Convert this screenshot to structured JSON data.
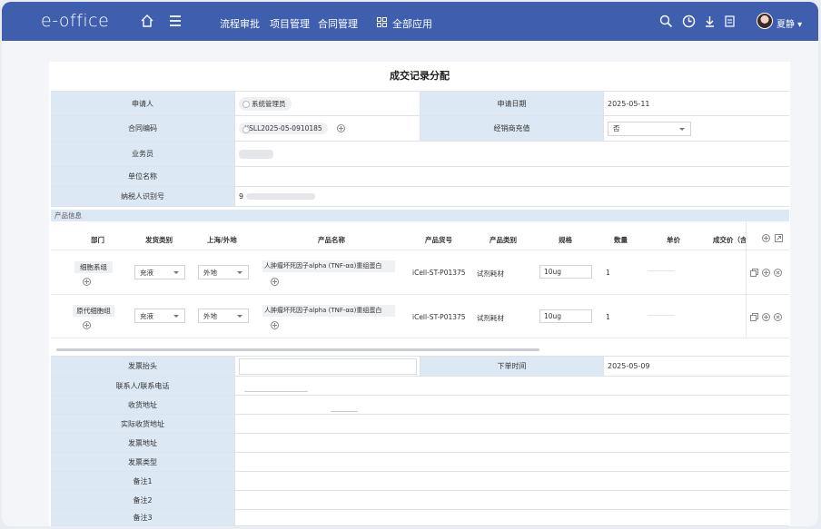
{
  "topbar": {
    "logo": "e-office",
    "nav": [
      "流程审批",
      "项目管理",
      "合同管理"
    ],
    "all_apps": "全部应用",
    "username": "夏静",
    "bg_color": "#3f5fae"
  },
  "form": {
    "title": "成交记录分配",
    "applicant_label": "申请人",
    "applicant_value": "系统管理员",
    "apply_date_label": "申请日期",
    "apply_date_value": "2025-05-11",
    "contract_no_label": "合同编码",
    "contract_no_value": "XSLL2025-05-0910185",
    "dealer_label": "经销商充值",
    "dealer_value": "否",
    "salesman_label": "业务员",
    "unit_label": "单位名称",
    "taxid_label": "纳税人识别号",
    "taxid_value": "9",
    "product_section": "产品信息",
    "invoice_head_label": "发票抬头",
    "order_time_label": "下单时间",
    "order_time_value": "2025-05-09",
    "contact_label": "联系人/联系电话",
    "ship_addr_label": "收货地址",
    "real_addr_label": "实际收货地址",
    "invoice_addr_label": "发票地址",
    "invoice_type_label": "发票类型",
    "note1_label": "备注1",
    "note2_label": "备注2",
    "note3_label": "备注3"
  },
  "products": {
    "headers": [
      "部门",
      "发货类别",
      "上海/外地",
      "产品名称",
      "产品货号",
      "产品类别",
      "规格",
      "数量",
      "单价",
      "成交价（含"
    ],
    "rows": [
      {
        "dept": "细胞系组",
        "ship_type": "充液",
        "region": "外地",
        "name": "人肿瘤坏死因子alpha (TNF-αα)重组蛋白",
        "code": "iCell-ST-P01375",
        "category": "试剂耗材",
        "spec": "10ug",
        "qty": "1"
      },
      {
        "dept": "原代细胞组",
        "ship_type": "充液",
        "region": "外地",
        "name": "人肿瘤坏死因子alpha (TNF-αα)重组蛋白",
        "code": "iCell-ST-P01375",
        "category": "试剂耗材",
        "spec": "10ug",
        "qty": "1"
      }
    ]
  }
}
